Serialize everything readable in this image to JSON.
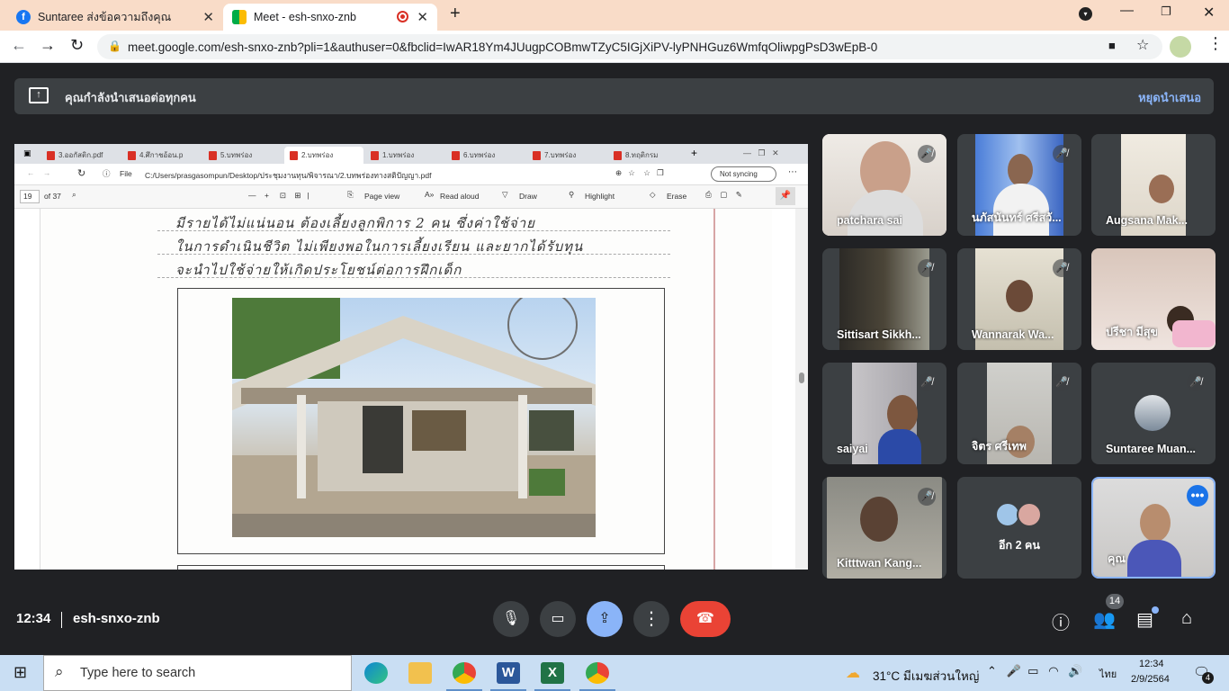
{
  "browser": {
    "tabs": [
      {
        "title": "Suntaree ส่งข้อความถึงคุณ",
        "icon": "facebook-icon"
      },
      {
        "title": "Meet - esh-snxo-znb",
        "icon": "google-meet-icon",
        "recording": true
      }
    ],
    "url": "meet.google.com/esh-snxo-znb?pli=1&authuser=0&fbclid=IwAR18Ym4JUugpCOBmwTZyC5IGjXiPV-lyPNHGuz6WmfqOliwpgPsD3wEpB-0"
  },
  "meet": {
    "presenting_text": "คุณกำลังนำเสนอต่อทุกคน",
    "stop_presenting": "หยุดนำเสนอ",
    "time": "12:34",
    "meeting_code": "esh-snxo-znb",
    "participants_badge": "14",
    "more_count_label": "อีก 2 คน",
    "you_label": "คุณ",
    "participants": [
      "patchara sai",
      "นภัสนันทร์ ศรีสวั...",
      "Augsana Mak...",
      "Sittisart Sikkh...",
      "Wannarak Wa...",
      "ปรีชา มีสุข",
      "saiyai",
      "จิตร ศรีเทพ",
      "Suntaree Muan...",
      "Kitttwan Kang..."
    ]
  },
  "shared_screen": {
    "tabs": [
      "3.ออกัสติก.pdf",
      "4.ศึกาชอ้อน.p",
      "5.บทพร่อง",
      "2.บทพร่อง",
      "1.บทพร่อง",
      "6.บทพร่อง",
      "7.บทพร่อง",
      "8.ทฤติกรม"
    ],
    "file_label": "File",
    "file_path": "C:/Users/prasgasompun/Desktop/ประชุมงานทุน/พิจารณา/2.บทพร่องทางสติปัญญา.pdf",
    "not_syncing": "Not syncing",
    "page_current": "19",
    "page_total": "of 37",
    "page_view": "Page view",
    "read_aloud": "Read aloud",
    "draw": "Draw",
    "highlight": "Highlight",
    "erase": "Erase",
    "handwriting": [
      "มีรายได้ไม่แน่นอน ต้องเลี้ยงลูกพิการ 2 คน ซึ่งค่าใช้จ่าย",
      "ในการดำเนินชีวิต ไม่เพียงพอในการเลี้ยงเรียน และยากได้รับทุน",
      "จะนำไปใช้จ่ายให้เกิดประโยชน์ต่อการฝึกเด็ก"
    ]
  },
  "taskbar": {
    "search_placeholder": "Type here to search",
    "weather": "31°C มีเมฆส่วนใหญ่",
    "lang": "ไทย",
    "time": "12:34",
    "date": "2/9/2564",
    "notifications": "4"
  }
}
